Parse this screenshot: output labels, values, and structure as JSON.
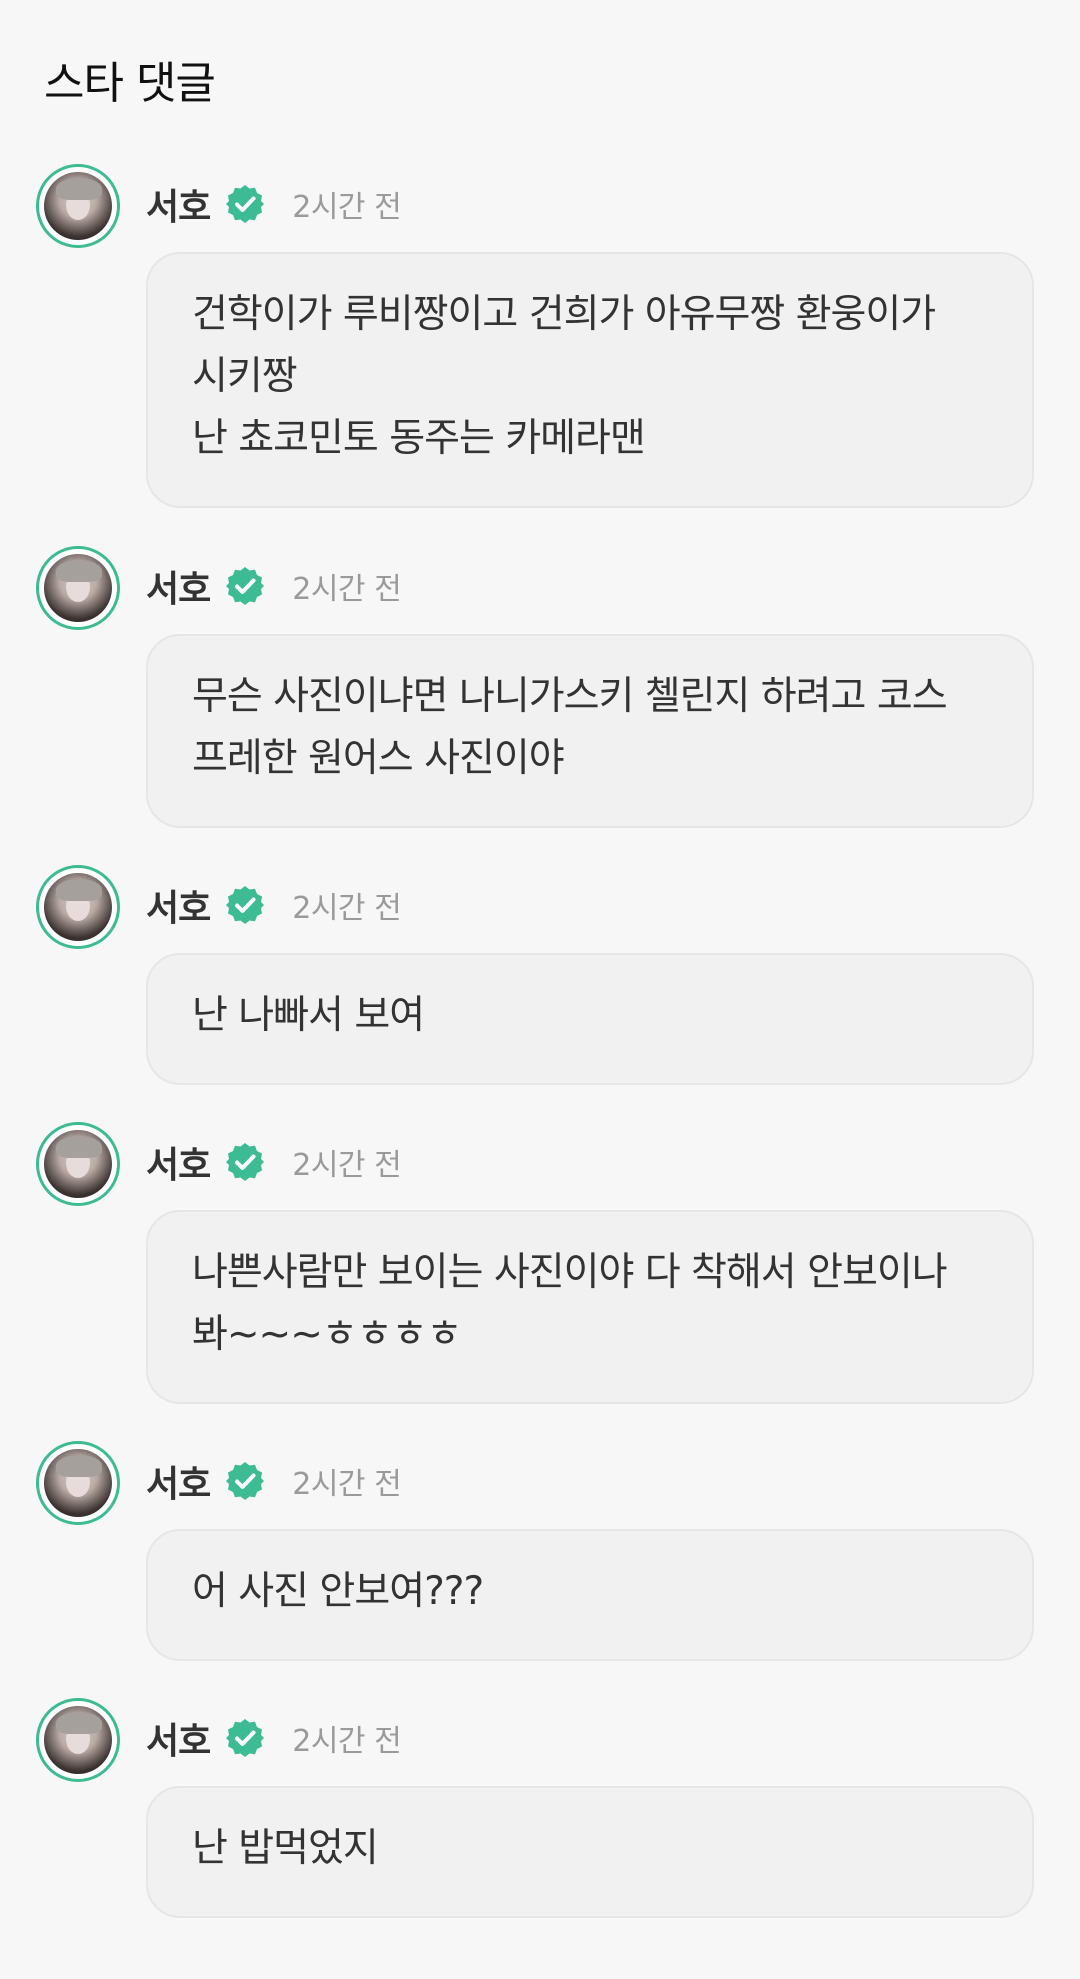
{
  "header": {
    "title": "스타 댓글"
  },
  "colors": {
    "accent": "#3dbb92",
    "background": "#f7f7f7",
    "bubble": "#f1f1f1",
    "timestamp": "#9a9a9a"
  },
  "comments": [
    {
      "author": "서호",
      "verified_icon": "verified-badge-icon",
      "time": "2시간 전",
      "text": "건학이가 루비짱이고 건희가 아유무짱 환웅이가\n시키짱\n난 쵸코민토 동주는 카메라맨"
    },
    {
      "author": "서호",
      "verified_icon": "verified-badge-icon",
      "time": "2시간 전",
      "text": "무슨 사진이냐면 나니가스키 첼린지 하려고 코스\n프레한 원어스 사진이야"
    },
    {
      "author": "서호",
      "verified_icon": "verified-badge-icon",
      "time": "2시간 전",
      "text": "난 나빠서 보여"
    },
    {
      "author": "서호",
      "verified_icon": "verified-badge-icon",
      "time": "2시간 전",
      "text": "나쁜사람만 보이는 사진이야 다 착해서 안보이나\n봐~~~ㅎㅎㅎㅎ"
    },
    {
      "author": "서호",
      "verified_icon": "verified-badge-icon",
      "time": "2시간 전",
      "text": "어 사진 안보여???"
    },
    {
      "author": "서호",
      "verified_icon": "verified-badge-icon",
      "time": "2시간 전",
      "text": "난 밥먹었지"
    }
  ]
}
